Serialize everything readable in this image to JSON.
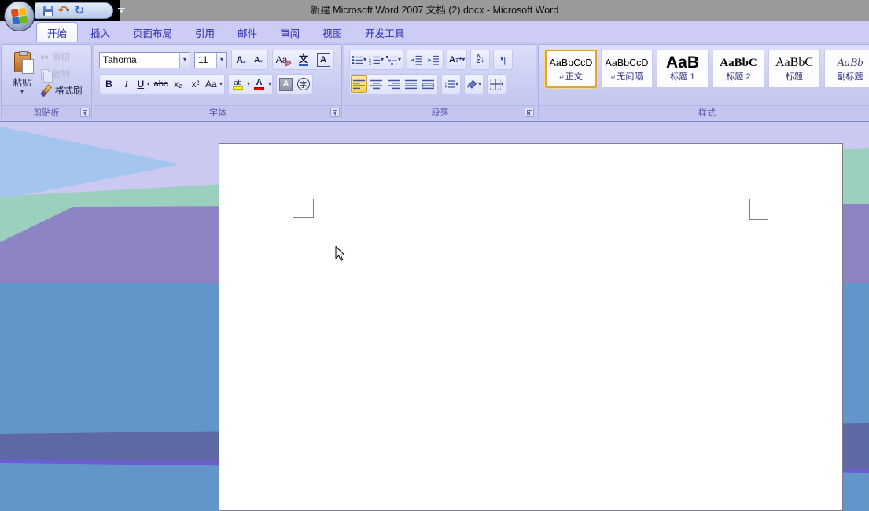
{
  "window": {
    "title": "新建 Microsoft Word 2007 文档 (2).docx - Microsoft Word"
  },
  "quick_access": {
    "icon_names": [
      "office-button",
      "save-icon",
      "undo-icon",
      "redo-icon",
      "customize-quick-access-icon"
    ]
  },
  "tabs": [
    {
      "label": "开始",
      "active": true
    },
    {
      "label": "插入",
      "active": false
    },
    {
      "label": "页面布局",
      "active": false
    },
    {
      "label": "引用",
      "active": false
    },
    {
      "label": "邮件",
      "active": false
    },
    {
      "label": "审阅",
      "active": false
    },
    {
      "label": "视图",
      "active": false
    },
    {
      "label": "开发工具",
      "active": false
    }
  ],
  "ribbon": {
    "clipboard": {
      "label": "剪贴板",
      "paste": "粘贴",
      "cut": "剪切",
      "copy": "复制",
      "format_painter": "格式刷"
    },
    "font": {
      "label": "字体",
      "font_name": "Tahoma",
      "font_size": "11",
      "glyphs": {
        "grow_font": "A",
        "shrink_font": "A",
        "clear_formatting": "Aa",
        "phonetic_guide": "文",
        "character_border": "A",
        "bold": "B",
        "italic": "I",
        "underline": "U",
        "strikethrough": "abc",
        "subscript": "x₂",
        "superscript": "x²",
        "change_case": "Aa",
        "text_highlight": "ab",
        "font_color": "A",
        "character_shading": "A",
        "enclose_characters": "字"
      }
    },
    "paragraph": {
      "label": "段落"
    },
    "styles": {
      "label": "样式",
      "items": [
        {
          "preview": "AaBbCcD",
          "name": "正文",
          "mark": "↵",
          "selected": true
        },
        {
          "preview": "AaBbCcD",
          "name": "无间隔",
          "mark": "↵",
          "selected": false
        },
        {
          "preview": "AaB",
          "name": "标题 1",
          "mark": "",
          "selected": false
        },
        {
          "preview": "AaBbC",
          "name": "标题 2",
          "mark": "",
          "selected": false
        },
        {
          "preview": "AaBbC",
          "name": "标题",
          "mark": "",
          "selected": false
        },
        {
          "preview": "AaBb",
          "name": "副标题",
          "mark": "",
          "selected": false
        }
      ]
    }
  },
  "icons": {
    "caret": "▾",
    "scissors": "✂",
    "pilcrow": "¶",
    "undo": "↶",
    "redo": "↻",
    "up_down": "↕",
    "left_right": "⇄",
    "down_arrow": "↓"
  },
  "colors": {
    "titlebar_gray": "#9a9a9a",
    "tab_row_lavender": "#cdccf7",
    "ribbon_lavender": "#c5c8f3",
    "selection_orange": "#ffd24e",
    "highlight_yellow": "#ffff00",
    "font_color_red": "#ff0000",
    "wallpaper_lavender": "#cbc8f2",
    "wallpaper_light_blue": "#a4c6ee",
    "wallpaper_teal": "#9bcfbe",
    "wallpaper_purple": "#8c84c3",
    "wallpaper_steel_blue": "#6296ca",
    "wallpaper_dark_band": "#5d68a5"
  }
}
